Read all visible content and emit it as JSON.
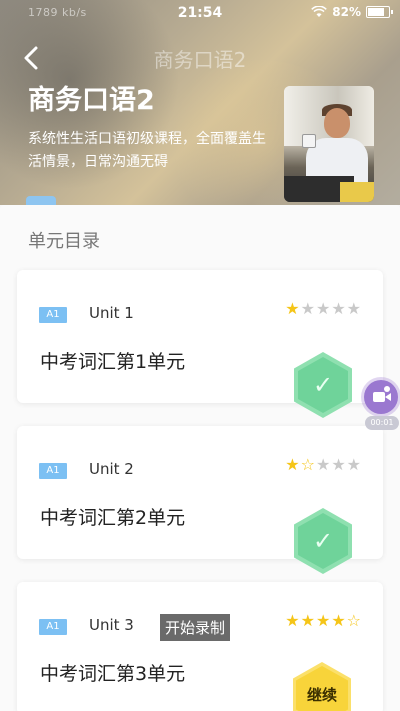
{
  "status_bar": {
    "left_text": "1789 kb/s",
    "time": "21:54",
    "battery": "82%",
    "battery_level": 0.82
  },
  "header": {
    "nav_title": "商务口语2",
    "course_title": "商务口语2",
    "description": "系统性生活口语初级课程，全面覆盖生活情景，日常沟通无碍"
  },
  "section_title": "单元目录",
  "units": [
    {
      "level": "A1",
      "label": "Unit 1",
      "name": "中考词汇第1单元",
      "rating": 1,
      "max_rating": 5,
      "status": "completed"
    },
    {
      "level": "A1",
      "label": "Unit 2",
      "name": "中考词汇第2单元",
      "rating": 1,
      "max_rating": 5,
      "status": "completed"
    },
    {
      "level": "A1",
      "label": "Unit 3",
      "name": "中考词汇第3单元",
      "rating": 4,
      "max_rating": 5,
      "status": "continue",
      "action_label": "继续"
    }
  ],
  "recorder": {
    "time": "00:01",
    "toast": "开始录制"
  },
  "colors": {
    "level_badge": "#7cc0f3",
    "star": "#f5c518",
    "done_hex": "#6fd39a",
    "continue_hex": "#f8d43a",
    "recorder": "#9a78d0"
  },
  "icons": {
    "back": "chevron-left-icon",
    "done": "check-icon",
    "recorder": "video-camera-icon"
  }
}
